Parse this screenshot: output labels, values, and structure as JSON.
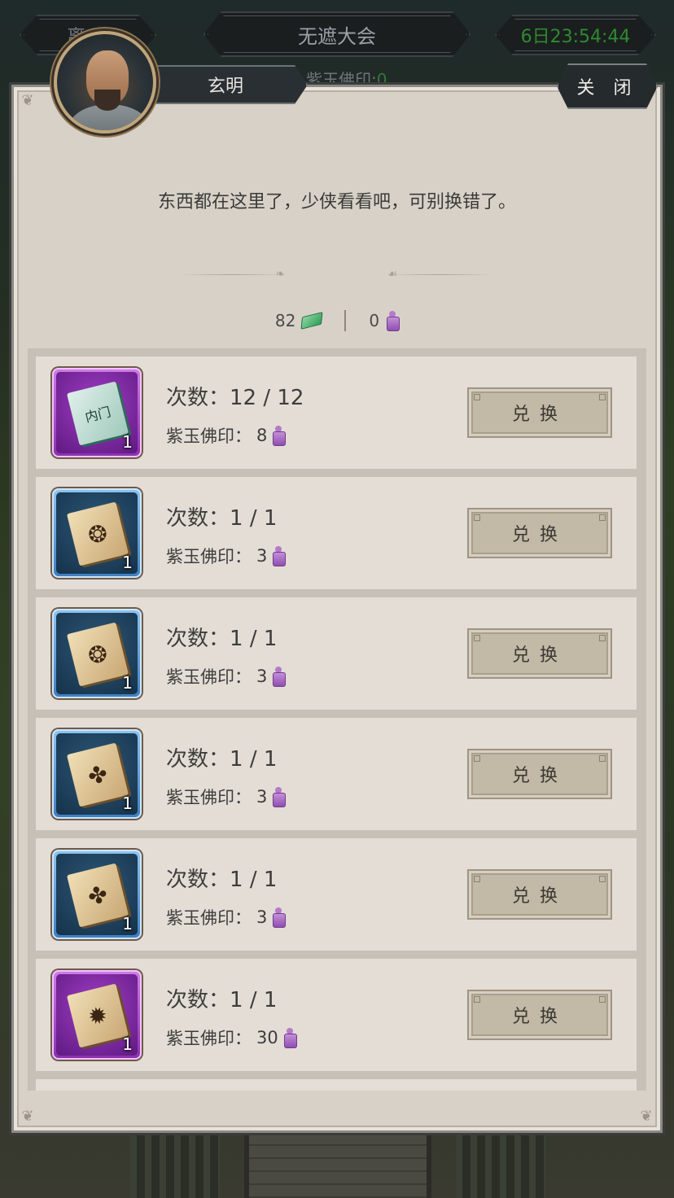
{
  "topbar": {
    "leave_label": "离 开",
    "title": "无遮大会",
    "timer": "6日23:54:44",
    "currency_caption": "紫玉佛印:",
    "currency_caption_value": "0"
  },
  "npc": {
    "name": "玄明",
    "dialog": "东西都在这里了，少侠看看吧，可别换错了。"
  },
  "close_label": "关 闭",
  "wallet": {
    "jade_amount": "82",
    "seal_amount": "0"
  },
  "items": [
    {
      "rarity": "purple",
      "book": "manual",
      "book_text": "内门",
      "count": "1",
      "times_label": "次数：",
      "times": "12 / 12",
      "price_label": "紫玉佛印：",
      "price": "8",
      "button": "兑换"
    },
    {
      "rarity": "blue",
      "book": "scroll",
      "book_text": "❂",
      "count": "1",
      "times_label": "次数：",
      "times": "1 / 1",
      "price_label": "紫玉佛印：",
      "price": "3",
      "button": "兑换"
    },
    {
      "rarity": "blue",
      "book": "scroll",
      "book_text": "❂",
      "count": "1",
      "times_label": "次数：",
      "times": "1 / 1",
      "price_label": "紫玉佛印：",
      "price": "3",
      "button": "兑换"
    },
    {
      "rarity": "blue",
      "book": "scroll",
      "book_text": "✤",
      "count": "1",
      "times_label": "次数：",
      "times": "1 / 1",
      "price_label": "紫玉佛印：",
      "price": "3",
      "button": "兑换"
    },
    {
      "rarity": "blue",
      "book": "scroll",
      "book_text": "✤",
      "count": "1",
      "times_label": "次数：",
      "times": "1 / 1",
      "price_label": "紫玉佛印：",
      "price": "3",
      "button": "兑换"
    },
    {
      "rarity": "purple",
      "book": "scroll",
      "book_text": "✹",
      "count": "1",
      "times_label": "次数：",
      "times": "1 / 1",
      "price_label": "紫玉佛印：",
      "price": "30",
      "button": "兑换"
    }
  ],
  "colors": {
    "panel": "#d8d1c8",
    "row": "#e3ddd6",
    "button": "#c2b9a6",
    "timer_green": "#2f8a2f",
    "seal_purple": "#b57ac9",
    "jade_green": "#2e9e5a"
  },
  "icons": {
    "jade": "jade-currency-icon",
    "seal": "purple-seal-icon"
  }
}
